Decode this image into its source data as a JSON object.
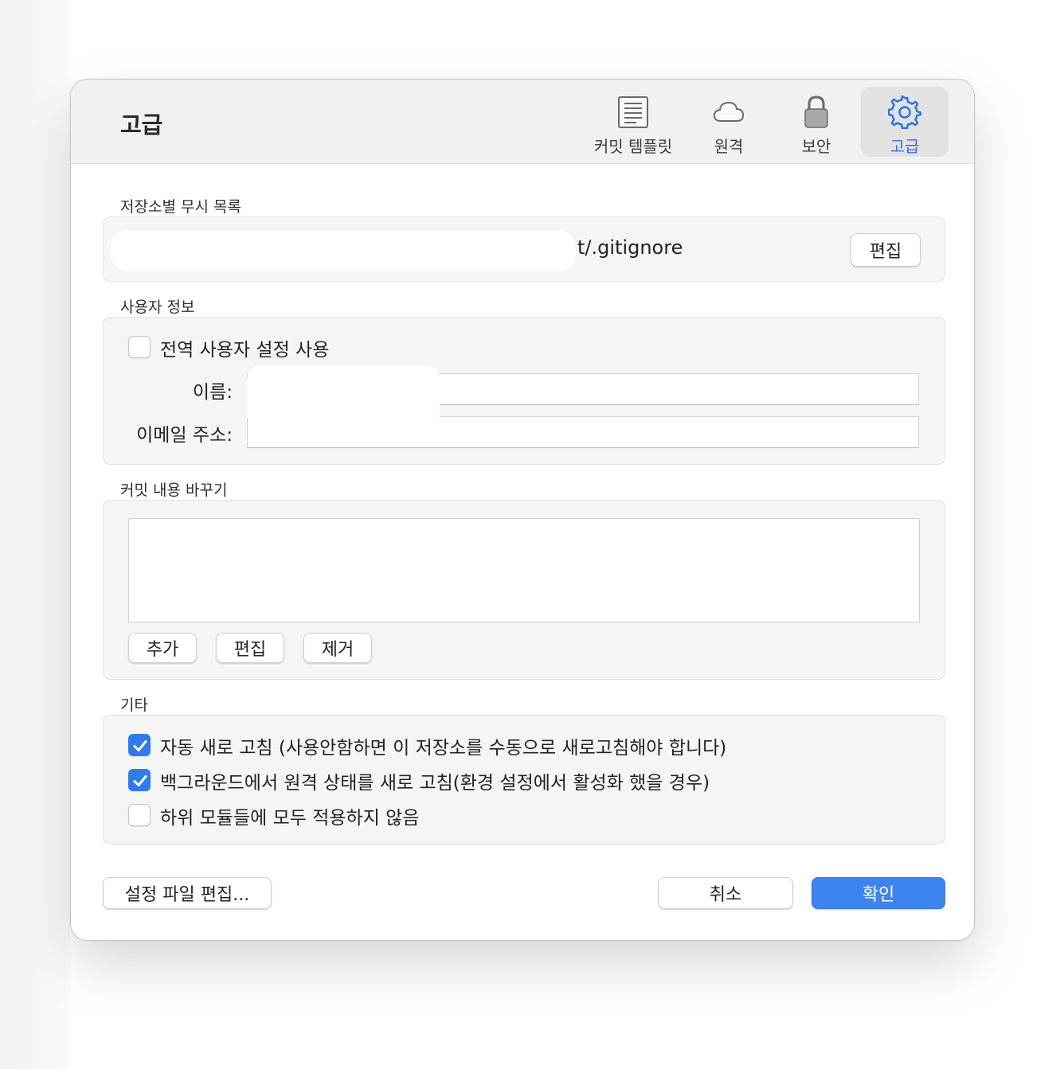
{
  "window": {
    "title": "고급"
  },
  "tabs": [
    {
      "label": "커밋 템플릿",
      "icon": "document-lines-icon"
    },
    {
      "label": "원격",
      "icon": "cloud-icon"
    },
    {
      "label": "보안",
      "icon": "lock-icon"
    },
    {
      "label": "고급",
      "icon": "gear-icon",
      "selected": true
    }
  ],
  "ignore_list": {
    "title": "저장소별 무시 목록",
    "path_visible": "t/.gitignore",
    "edit_label": "편집"
  },
  "user_info": {
    "title": "사용자 정보",
    "use_global_label": "전역 사용자 설정 사용",
    "use_global_checked": false,
    "name_label": "이름:",
    "name_value": "",
    "email_label": "이메일 주소:",
    "email_value": ""
  },
  "commit_replace": {
    "title": "커밋 내용 바꾸기",
    "add_label": "추가",
    "edit_label": "편집",
    "remove_label": "제거"
  },
  "misc": {
    "title": "기타",
    "options": [
      {
        "label": "자동 새로 고침 (사용안함하면 이 저장소를 수동으로 새로고침해야 합니다)",
        "checked": true
      },
      {
        "label": "백그라운드에서 원격 상태를 새로 고침(환경 설정에서 활성화 했을 경우)",
        "checked": true
      },
      {
        "label": "하위 모듈들에 모두 적용하지 않음",
        "checked": false
      }
    ]
  },
  "footer": {
    "edit_config_label": "설정 파일 편집...",
    "cancel_label": "취소",
    "ok_label": "확인"
  },
  "colors": {
    "accent": "#2f7bea",
    "primary_button": "#3d84ee"
  }
}
